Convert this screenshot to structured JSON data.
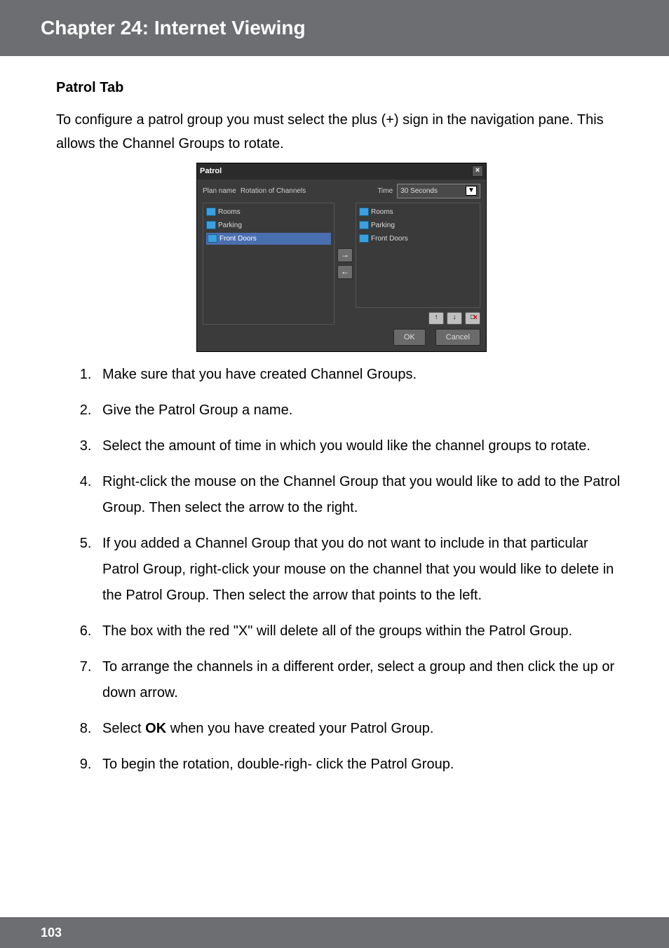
{
  "header": {
    "chapter_title": "Chapter 24: Internet Viewing"
  },
  "section": {
    "subhead": "Patrol Tab"
  },
  "intro": "To configure a patrol group you must select the plus (+) sign in the navigation pane. This allows the Channel Groups to rotate.",
  "screenshot": {
    "window_title": "Patrol",
    "close_glyph": "×",
    "plan_name_label": "Plan name",
    "plan_name_value": "Rotation of Channels",
    "time_label": "Time",
    "time_value": "30 Seconds",
    "dropdown_glyph": "▼",
    "left_list": {
      "items": [
        "Rooms",
        "Parking",
        "Front Doors"
      ],
      "selected_index": 2
    },
    "right_list": {
      "items": [
        "Rooms",
        "Parking",
        "Front Doors"
      ]
    },
    "move_right_glyph": "→",
    "move_left_glyph": "←",
    "up_glyph": "↑",
    "down_glyph": "↓",
    "delete_glyph": "□",
    "ok_label": "OK",
    "cancel_label": "Cancel"
  },
  "steps": {
    "s1": "Make sure that you have created Channel Groups.",
    "s2": "Give the Patrol Group a name.",
    "s3": "Select the amount of time in which you would like the channel groups to rotate.",
    "s4": "Right-click the mouse on the Channel Group that you would like to add to the Patrol Group. Then select the arrow to the right.",
    "s5": "If you added a Channel Group that you do not want to include in that particular Patrol Group, right-click your mouse on the channel that you would like to delete in the Patrol Group. Then select the arrow that points to the left.",
    "s6": "The box with the red \"X\" will delete all of the groups within the Patrol Group.",
    "s7": "To arrange the channels in a different order, select a group and then click the up or down arrow.",
    "s8_pre": "Select ",
    "s8_bold": "OK",
    "s8_post": " when you have created your Patrol Group.",
    "s9": "To begin the rotation, double-righ- click the Patrol Group."
  },
  "footer": {
    "page_number": "103"
  }
}
